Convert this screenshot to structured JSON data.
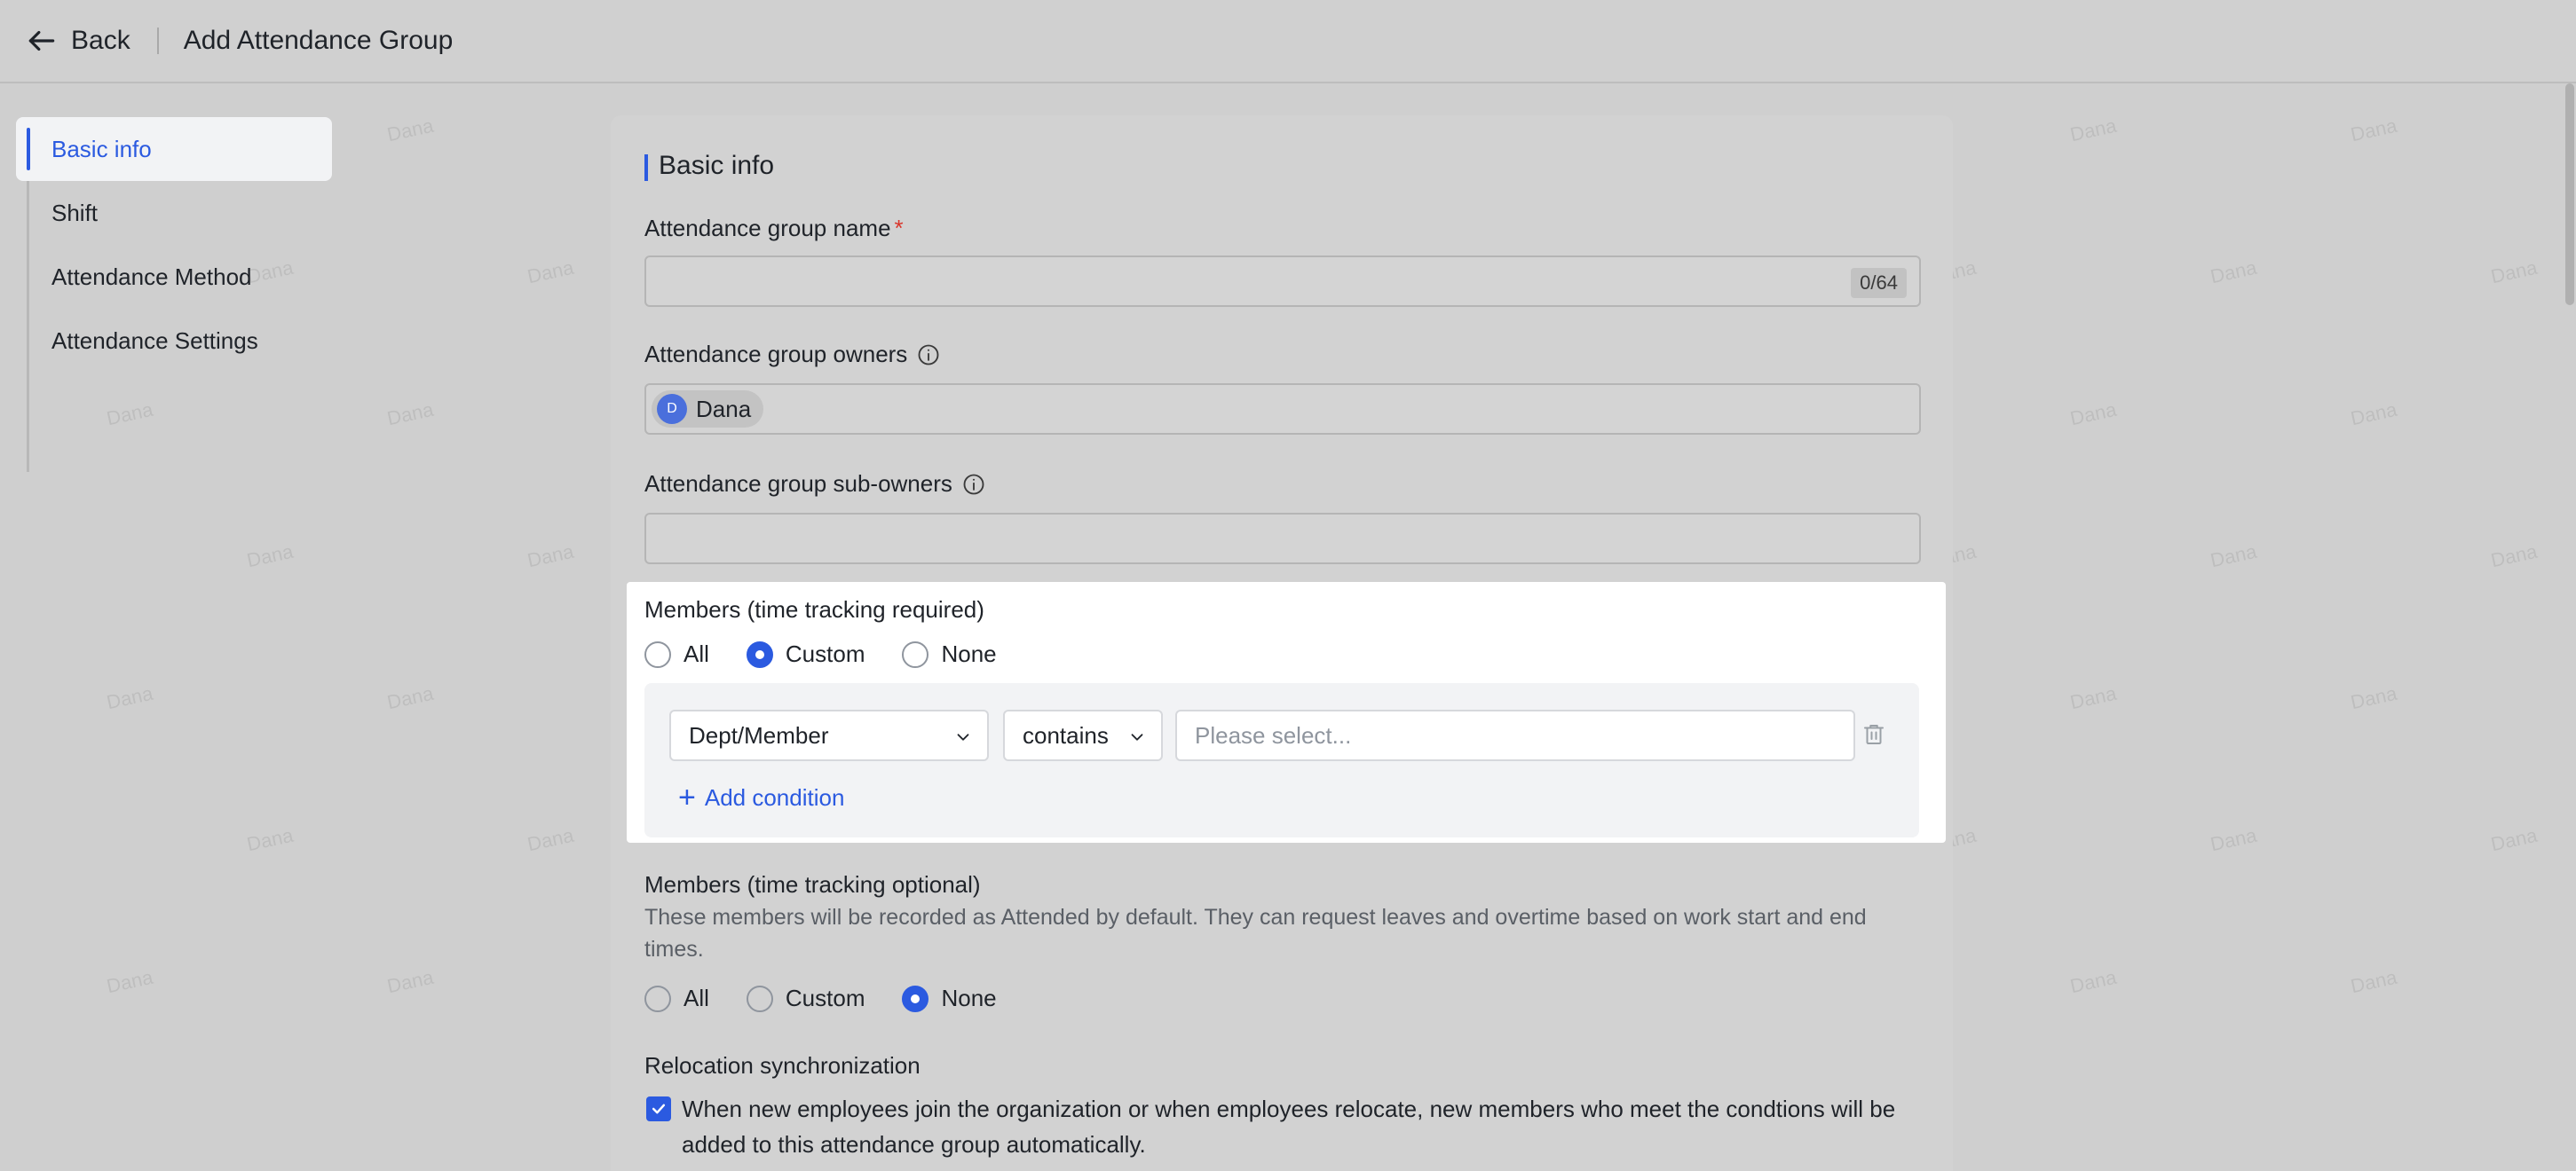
{
  "header": {
    "back_label": "Back",
    "title": "Add Attendance Group"
  },
  "sidebar": {
    "items": [
      {
        "label": "Basic info",
        "active": true
      },
      {
        "label": "Shift",
        "active": false
      },
      {
        "label": "Attendance Method",
        "active": false
      },
      {
        "label": "Attendance Settings",
        "active": false
      }
    ]
  },
  "watermark_text": "Dana",
  "form": {
    "section_title": "Basic info",
    "group_name": {
      "label": "Attendance group name",
      "required_mark": "*",
      "value": "",
      "counter": "0/64"
    },
    "owners": {
      "label": "Attendance group owners",
      "chips": [
        {
          "initial": "D",
          "name": "Dana"
        }
      ]
    },
    "sub_owners": {
      "label": "Attendance group sub-owners",
      "value": ""
    },
    "members_required": {
      "title": "Members (time tracking required)",
      "options": [
        "All",
        "Custom",
        "None"
      ],
      "selected": "Custom",
      "condition": {
        "field": "Dept/Member",
        "operator": "contains",
        "value_placeholder": "Please select..."
      },
      "add_condition_label": "Add condition"
    },
    "members_optional": {
      "title": "Members (time tracking optional)",
      "description": "These members will be recorded as Attended by default. They can request leaves and overtime based on work start and end times.",
      "options": [
        "All",
        "Custom",
        "None"
      ],
      "selected": "None"
    },
    "relocation": {
      "title": "Relocation synchronization",
      "checked": true,
      "text": "When new employees join the organization or when employees relocate, new members who meet the condtions will be added to this attendance group automatically."
    }
  },
  "colors": {
    "accent": "#2b5ae0",
    "overlay": "#cfcfcf",
    "required": "#d9352b"
  }
}
